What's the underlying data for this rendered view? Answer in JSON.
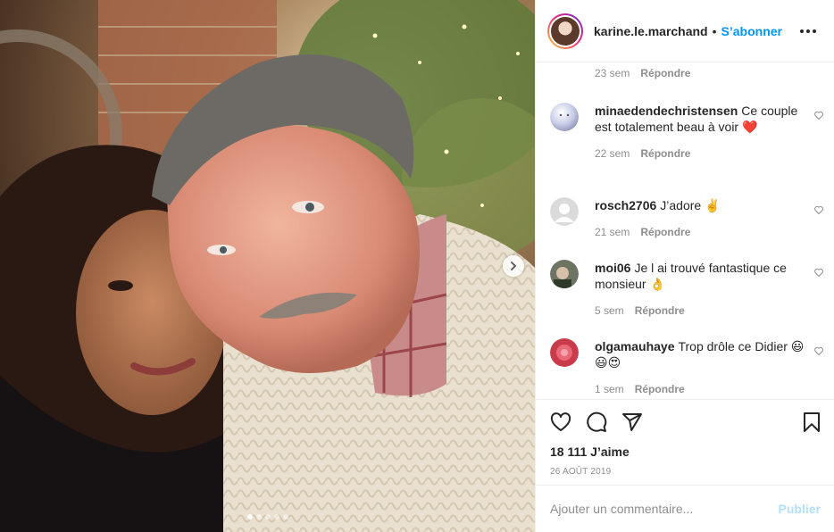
{
  "post": {
    "username": "karine.le.marchand",
    "separator": "•",
    "follow_label": "S’abonner",
    "previous_comment_meta": {
      "age": "23 sem",
      "reply": "Répondre"
    },
    "comments": [
      {
        "user": "minaedendechristensen",
        "text": "Ce couple est totalement beau à voir ❤️",
        "age": "22 sem",
        "reply": "Répondre",
        "avatar": "moon-avatar"
      },
      {
        "user": "rosch2706",
        "text": "J’adore ✌️",
        "age": "21 sem",
        "reply": "Répondre",
        "avatar": "default-avatar"
      },
      {
        "user": "moi06",
        "text": "Je l ai trouvé fantastique ce monsieur 👌",
        "age": "5 sem",
        "reply": "Répondre",
        "avatar": "photo-avatar"
      },
      {
        "user": "olgamauhaye",
        "text": "Trop drôle ce Didier 😃😃😍",
        "age": "1 sem",
        "reply": "Répondre",
        "avatar": "rose-avatar"
      }
    ],
    "likes": "18 111 J’aime",
    "date": "26 AOÛT 2019",
    "add_comment_placeholder": "Ajouter un commentaire...",
    "publish_label": "Publier",
    "carousel": {
      "count": 5,
      "active": 1
    },
    "colors": {
      "link": "#0095f6",
      "publish_disabled": "#b2dffc",
      "muted": "#8e8e8e",
      "text": "#262626"
    }
  }
}
